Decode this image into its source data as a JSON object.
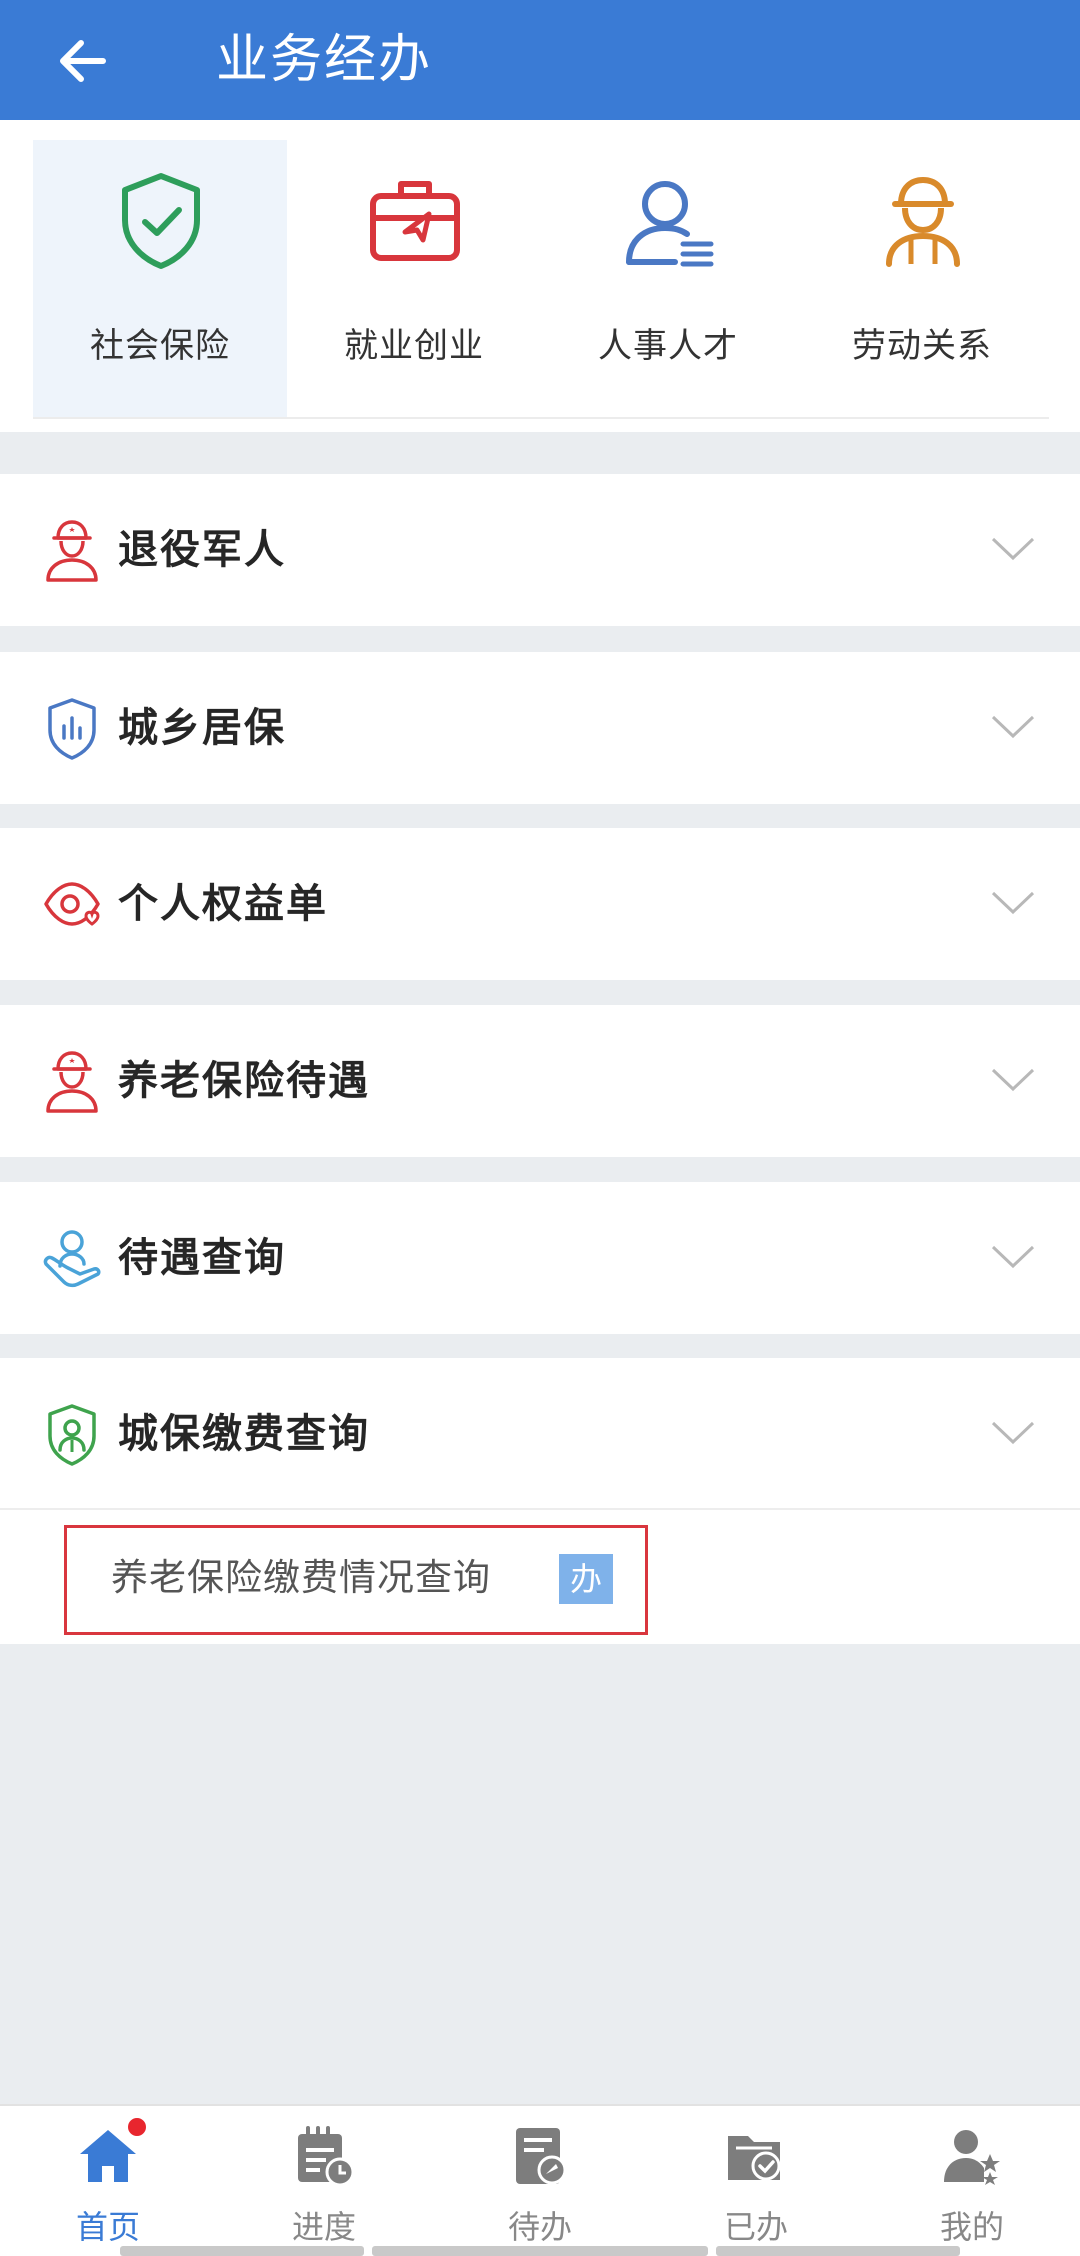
{
  "header": {
    "title": "业务经办",
    "back_icon": "arrow-left-icon"
  },
  "categories": [
    {
      "label": "社会保险",
      "icon": "shield-check-icon",
      "active": true
    },
    {
      "label": "就业创业",
      "icon": "briefcase-icon",
      "active": false
    },
    {
      "label": "人事人才",
      "icon": "person-list-icon",
      "active": false
    },
    {
      "label": "劳动关系",
      "icon": "worker-icon",
      "active": false
    }
  ],
  "sections": [
    {
      "title": "退役军人",
      "icon": "soldier-icon"
    },
    {
      "title": "城乡居保",
      "icon": "shield-chart-icon"
    },
    {
      "title": "个人权益单",
      "icon": "eye-heart-icon"
    },
    {
      "title": "养老保险待遇",
      "icon": "soldier-icon"
    },
    {
      "title": "待遇查询",
      "icon": "hand-person-icon"
    },
    {
      "title": "城保缴费查询",
      "icon": "shield-person-icon"
    }
  ],
  "expanded_item": {
    "label": "养老保险缴费情况查询",
    "badge": "办"
  },
  "bottom_nav": [
    {
      "label": "首页",
      "icon": "home-icon",
      "active": true,
      "has_dot": true
    },
    {
      "label": "进度",
      "icon": "calendar-clock-icon",
      "active": false
    },
    {
      "label": "待办",
      "icon": "document-pending-icon",
      "active": false
    },
    {
      "label": "已办",
      "icon": "folder-check-icon",
      "active": false
    },
    {
      "label": "我的",
      "icon": "user-stars-icon",
      "active": false
    }
  ],
  "colors": {
    "header_bg": "#3a7bd5",
    "active_blue": "#3a7bd5",
    "highlight_border": "#d9363e",
    "badge_bg": "#7fb2ea"
  }
}
